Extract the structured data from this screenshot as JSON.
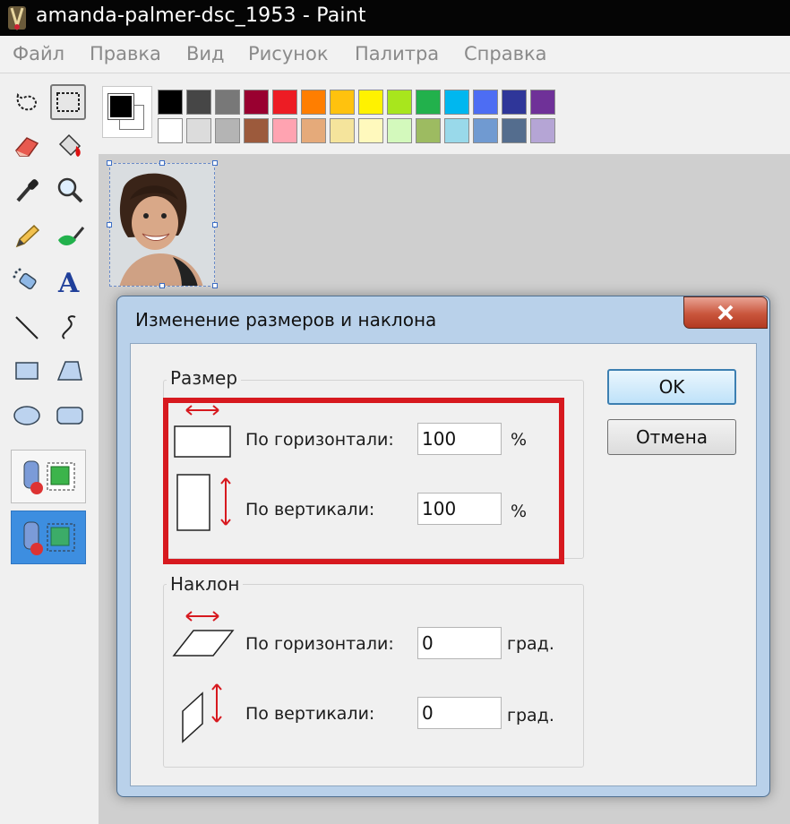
{
  "window": {
    "title": "amanda-palmer-dsc_1953 - Paint"
  },
  "menu": [
    "Файл",
    "Правка",
    "Вид",
    "Рисунок",
    "Палитра",
    "Справка"
  ],
  "palette": {
    "row1": [
      "#000000",
      "#464646",
      "#787878",
      "#990030",
      "#ed1c24",
      "#ff7e00",
      "#ffc20e",
      "#fff200",
      "#a8e61d",
      "#22b14c",
      "#00b7ef",
      "#4d6df3",
      "#2f3699",
      "#6f3198"
    ],
    "row2": [
      "#ffffff",
      "#dcdcdc",
      "#b4b4b4",
      "#9c5a3c",
      "#ffa3b1",
      "#e5aa7a",
      "#f5e49c",
      "#fff9bd",
      "#d3f9bc",
      "#9dbb61",
      "#99d9ea",
      "#709ad1",
      "#546d8e",
      "#b5a5d5"
    ]
  },
  "tools": [
    "free-select-icon",
    "rect-select-icon",
    "eraser-icon",
    "fill-icon",
    "picker-icon",
    "magnifier-icon",
    "pencil-icon",
    "brush-icon",
    "airbrush-icon",
    "text-icon",
    "line-icon",
    "curve-icon",
    "rectangle-icon",
    "polygon-icon",
    "ellipse-icon",
    "rounded-rect-icon"
  ],
  "dialog": {
    "title": "Изменение размеров и наклона",
    "resize": {
      "label": "Размер",
      "horizontal_label": "По горизонтали:",
      "horizontal_value": "100",
      "horizontal_unit": "%",
      "vertical_label": "По вертикали:",
      "vertical_value": "100",
      "vertical_unit": "%"
    },
    "skew": {
      "label": "Наклон",
      "horizontal_label": "По горизонтали:",
      "horizontal_value": "0",
      "horizontal_unit": "град.",
      "vertical_label": "По вертикали:",
      "vertical_value": "0",
      "vertical_unit": "град."
    },
    "ok_label": "OK",
    "cancel_label": "Отмена"
  },
  "colors": {
    "highlight": "#d7191f",
    "title_bar": "#050505",
    "dialog_frame": "#b9d1ea"
  }
}
